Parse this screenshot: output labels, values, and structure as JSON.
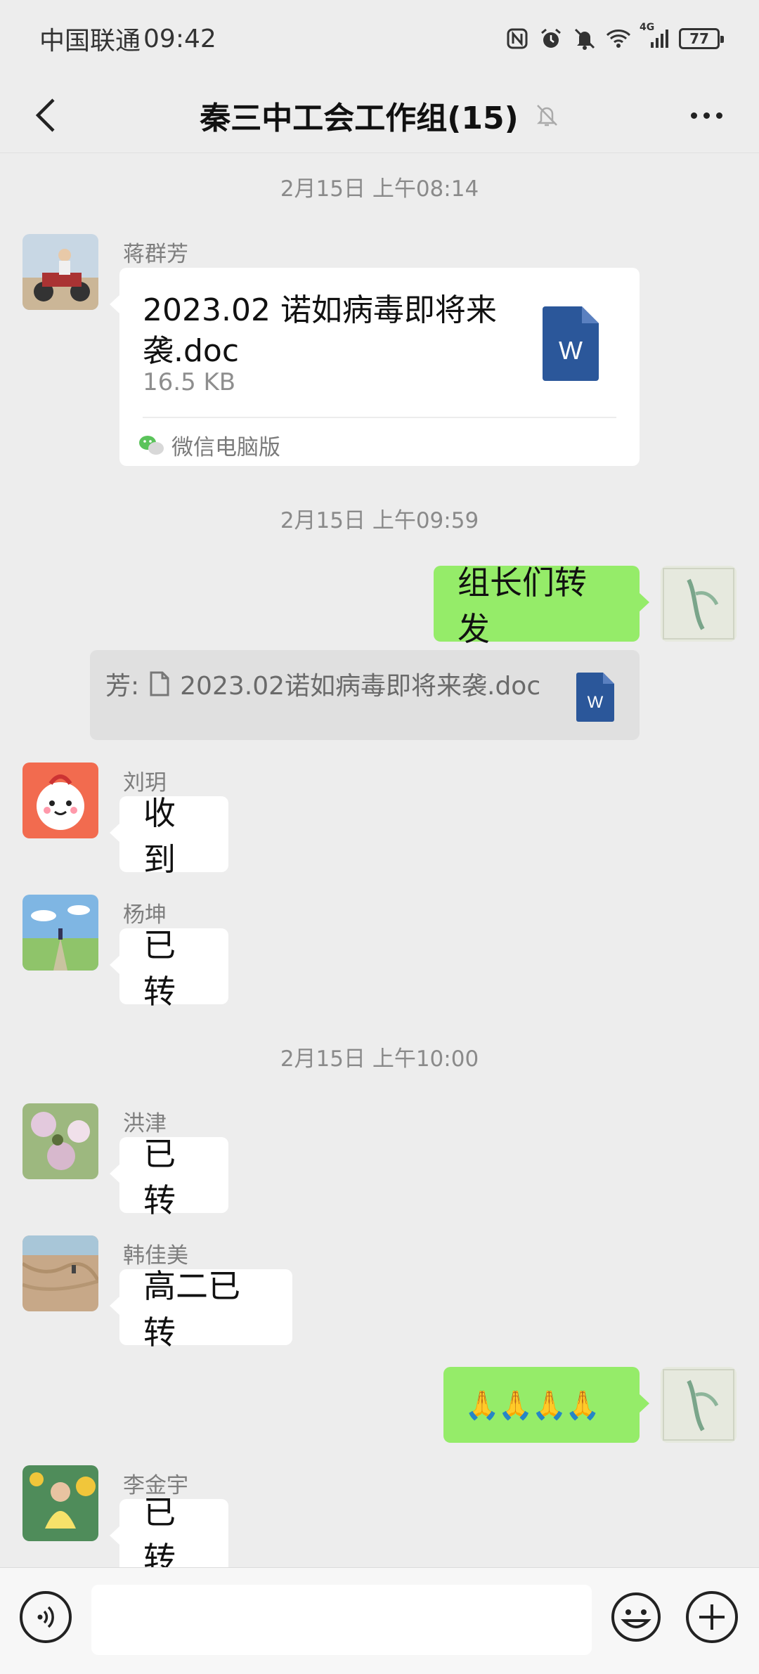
{
  "status_bar": {
    "carrier": "中国联通",
    "time": "09:42",
    "battery": "77",
    "network": "4G",
    "icons": [
      "nfc-icon",
      "alarm-icon",
      "mute-icon",
      "wifi-icon",
      "signal-icon",
      "battery-icon"
    ]
  },
  "nav": {
    "title": "秦三中工会工作组(15)",
    "back_icon": "chevron-left-icon",
    "mute_icon": "bell-off-icon",
    "more_icon": "more-dots-icon"
  },
  "timestamps": [
    "2月15日 上午08:14",
    "2月15日 上午09:59",
    "2月15日 上午10:00"
  ],
  "file_message": {
    "sender": "蒋群芳",
    "file_name": "2023.02 诺如病毒即将来袭.doc",
    "file_size": "16.5 KB",
    "file_type_letter": "W",
    "source": "微信电脑版"
  },
  "my_message_1": {
    "text": "组长们转发"
  },
  "quote": {
    "prefix": "芳:",
    "file_name": "2023.02诺如病毒即将来袭.doc",
    "file_type_letter": "W"
  },
  "messages": [
    {
      "sender": "刘玥",
      "text": "收到"
    },
    {
      "sender": "杨坤",
      "text": "已转"
    },
    {
      "sender": "洪津",
      "text": "已转"
    },
    {
      "sender": "韩佳美",
      "text": "高二已转"
    },
    {
      "sender": "李金宇",
      "text": "已转"
    }
  ],
  "my_message_2": {
    "text": "🙏🙏🙏🙏"
  },
  "input_bar": {
    "voice_icon": "voice-icon",
    "input_value": "",
    "emoji_icon": "emoji-icon",
    "plus_icon": "plus-icon"
  },
  "colors": {
    "background": "#ededed",
    "my_bubble": "#95ec69",
    "other_bubble": "#ffffff",
    "word_icon": "#2b579a"
  }
}
